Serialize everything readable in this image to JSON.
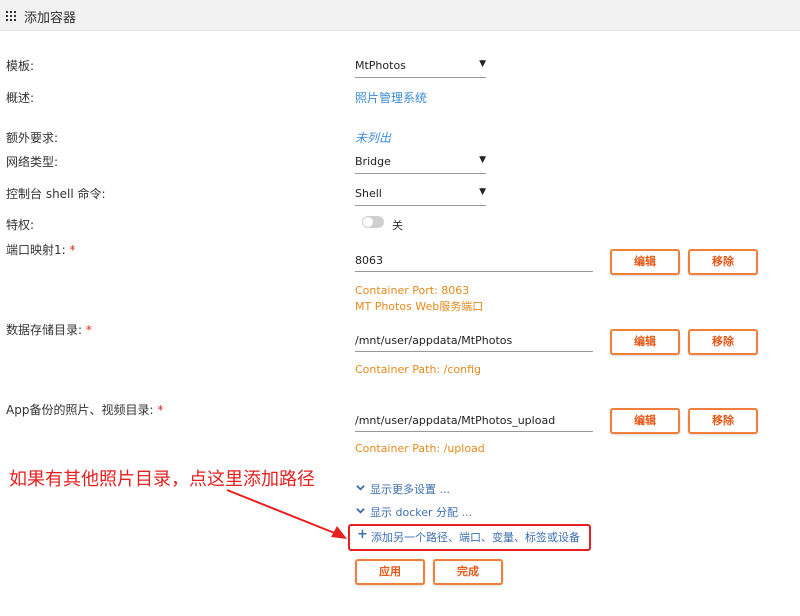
{
  "header": {
    "title": "添加容器",
    "icon": "grid-icon"
  },
  "fields": {
    "template": {
      "label": "模板:",
      "value": "MtPhotos"
    },
    "description": {
      "label": "概述:",
      "value": "照片管理系统"
    },
    "extra": {
      "label": "额外要求:",
      "value": "未列出"
    },
    "network": {
      "label": "网络类型:",
      "value": "Bridge"
    },
    "shell": {
      "label": "控制台 shell 命令:",
      "value": "Shell"
    },
    "privileged": {
      "label": "特权:",
      "state": "关",
      "on": false
    },
    "port1": {
      "label": "端口映射1:",
      "required": "*",
      "value": "8063",
      "hint1": "Container Port: 8063",
      "hint2": "MT Photos Web服务端口"
    },
    "data_dir": {
      "label": "数据存储目录:",
      "required": "*",
      "value": "/mnt/user/appdata/MtPhotos",
      "hint": "Container Path: /config"
    },
    "backup_dir": {
      "label": "App备份的照片、视频目录:",
      "required": "*",
      "value": "/mnt/user/appdata/MtPhotos_upload",
      "hint": "Container Path: /upload"
    }
  },
  "buttons": {
    "edit": "编辑",
    "remove": "移除",
    "apply": "应用",
    "done": "完成"
  },
  "more": {
    "show_more": "显示更多设置 ...",
    "show_docker": "显示 docker 分配 ...",
    "add_another": "添加另一个路径、端口、变量、标签或设备"
  },
  "annotation": {
    "text": "如果有其他照片目录，点这里添加路径",
    "color": "#e62020"
  },
  "colors": {
    "accent": "#f07f3c",
    "link": "#3c8ad9",
    "hint": "#e48a1b"
  }
}
